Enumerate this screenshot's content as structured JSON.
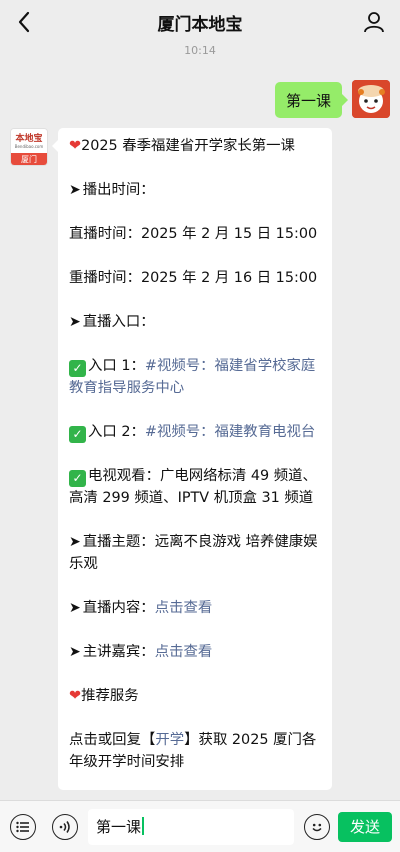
{
  "header": {
    "title": "厦门本地宝",
    "back_icon": "chevron-left-icon",
    "profile_icon": "person-icon"
  },
  "timestamp": "10:14",
  "outgoing": {
    "text": "第一课"
  },
  "incoming": {
    "avatar": {
      "logo_text": "本地宝",
      "logo_url": "Bendibao.com",
      "city": "厦门"
    },
    "paragraphs": [
      {
        "kind": "heart",
        "text": "2025 春季福建省开学家长第一课"
      },
      {
        "kind": "arrow",
        "text": "播出时间："
      },
      {
        "kind": "plain",
        "text": "直播时间：2025 年 2 月 15 日 15:00"
      },
      {
        "kind": "plain",
        "text": "重播时间：2025 年 2 月 16 日 15:00"
      },
      {
        "kind": "arrow",
        "text": "直播入口："
      },
      {
        "kind": "check",
        "prefix": "入口 1：",
        "link": "#视频号：福建省学校家庭教育指导服务中心"
      },
      {
        "kind": "check",
        "prefix": "入口 2：",
        "link": "#视频号：福建教育电视台"
      },
      {
        "kind": "check",
        "text": "电视观看：广电网络标清 49 频道、高清 299 频道、IPTV 机顶盒 31 频道"
      },
      {
        "kind": "arrow",
        "text": "直播主题：远离不良游戏 培养健康娱乐观"
      },
      {
        "kind": "arrow-link",
        "prefix": "直播内容：",
        "link": "点击查看"
      },
      {
        "kind": "arrow-link",
        "prefix": "主讲嘉宾：",
        "link": "点击查看"
      },
      {
        "kind": "heart",
        "text": "推荐服务"
      },
      {
        "kind": "reply",
        "before": "点击或回复【",
        "link": "开学",
        "after": "】获取 2025 厦门各年级开学时间安排"
      }
    ]
  },
  "input_bar": {
    "value": "第一课",
    "send_label": "发送",
    "icons": {
      "menu": "list-icon",
      "voice": "voice-icon",
      "emoji": "emoji-icon"
    }
  },
  "colors": {
    "bubble_out": "#95ec69",
    "link": "#576b95",
    "send": "#07c160"
  }
}
